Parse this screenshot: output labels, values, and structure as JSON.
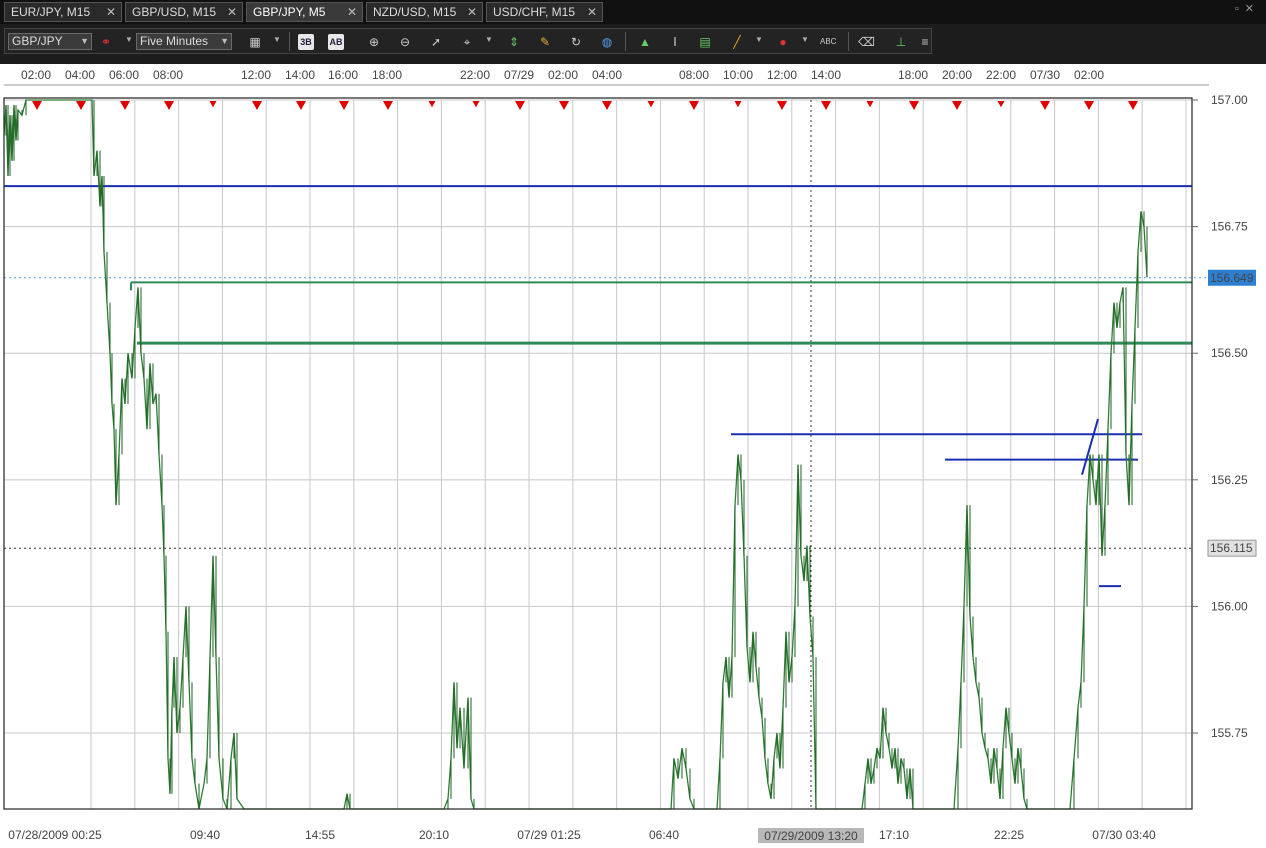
{
  "tabs": [
    {
      "label": "EUR/JPY, M15",
      "active": false
    },
    {
      "label": "GBP/USD, M15",
      "active": false
    },
    {
      "label": "GBP/JPY, M5",
      "active": true
    },
    {
      "label": "NZD/USD, M15",
      "active": false
    },
    {
      "label": "USD/CHF, M15",
      "active": false
    }
  ],
  "toolbar": {
    "symbol": "GBP/JPY",
    "timeframe": "Five Minutes",
    "icons": [
      "chart-type-icon",
      "dropdown-arrow-icon",
      "layout-a-icon",
      "layout-b-icon",
      "zoom-in-icon",
      "zoom-out-icon",
      "cursor-icon",
      "crosshair-icon",
      "dropdown-arrow-icon",
      "vertical-line-icon",
      "note-icon",
      "refresh-icon",
      "globe-icon",
      "indicator-icon",
      "text-cursor-icon",
      "panel-icon",
      "trend-line-icon",
      "dropdown-arrow-icon",
      "marker-icon",
      "dropdown-arrow-icon",
      "abc-text-icon",
      "eraser-icon",
      "tree-icon",
      "menu-icon"
    ]
  },
  "chart_data": {
    "type": "line",
    "symbol": "GBP/JPY",
    "timeframe": "M5",
    "top_axis_labels": [
      "02:00",
      "04:00",
      "06:00",
      "08:00",
      "12:00",
      "14:00",
      "16:00",
      "18:00",
      "22:00",
      "07/29",
      "02:00",
      "04:00",
      "08:00",
      "10:00",
      "12:00",
      "14:00",
      "18:00",
      "20:00",
      "22:00",
      "07/30",
      "02:00"
    ],
    "bottom_axis_labels": [
      "07/28/2009 00:25",
      "09:40",
      "14:55",
      "20:10",
      "07/29 01:25",
      "06:40",
      "17:10",
      "22:25",
      "07/30 03:40"
    ],
    "crosshair_time_label": "07/29/2009 13:20",
    "y_ticks": [
      "157.00",
      "156.75",
      "156.50",
      "156.25",
      "156.00",
      "155.75"
    ],
    "y_axis_range": [
      155.6,
      157.0
    ],
    "current_price": "156.649",
    "crosshair_price": "156.115",
    "horizontal_levels": [
      {
        "price": 156.83,
        "color": "#1a2fb0"
      },
      {
        "price": 156.64,
        "color": "#2e8b57"
      },
      {
        "price": 156.52,
        "color": "#2e8b57"
      },
      {
        "price": 156.34,
        "color": "#1a2fb0"
      },
      {
        "price": 156.29,
        "color": "#1a2fb0"
      },
      {
        "price": 156.04,
        "color": "#1a2fb0"
      }
    ],
    "session_markers": "red-down-triangles",
    "price_path": [
      [
        0,
        156.93
      ],
      [
        2,
        156.99
      ],
      [
        4,
        156.85
      ],
      [
        6,
        156.97
      ],
      [
        8,
        156.88
      ],
      [
        10,
        156.99
      ],
      [
        12,
        156.92
      ],
      [
        14,
        156.98
      ],
      [
        18,
        156.97
      ],
      [
        22,
        157.0
      ],
      [
        30,
        157.0
      ],
      [
        40,
        157.0
      ],
      [
        60,
        157.0
      ],
      [
        80,
        157.0
      ],
      [
        88,
        157.0
      ],
      [
        90,
        156.85
      ],
      [
        93,
        156.9
      ],
      [
        96,
        156.79
      ],
      [
        98,
        156.85
      ],
      [
        100,
        156.7
      ],
      [
        103,
        156.6
      ],
      [
        106,
        156.5
      ],
      [
        108,
        156.4
      ],
      [
        110,
        156.35
      ],
      [
        112,
        156.2
      ],
      [
        115,
        156.3
      ],
      [
        118,
        156.45
      ],
      [
        121,
        156.4
      ],
      [
        124,
        156.5
      ],
      [
        128,
        156.45
      ],
      [
        131,
        156.55
      ],
      [
        134,
        156.63
      ],
      [
        137,
        156.5
      ],
      [
        140,
        156.45
      ],
      [
        143,
        156.35
      ],
      [
        146,
        156.48
      ],
      [
        149,
        156.4
      ],
      [
        152,
        156.42
      ],
      [
        155,
        156.3
      ],
      [
        158,
        156.2
      ],
      [
        160,
        156.1
      ],
      [
        162,
        155.95
      ],
      [
        164,
        155.7
      ],
      [
        166,
        155.63
      ],
      [
        168,
        155.8
      ],
      [
        170,
        155.9
      ],
      [
        173,
        155.75
      ],
      [
        176,
        155.8
      ],
      [
        179,
        155.9
      ],
      [
        182,
        156.0
      ],
      [
        185,
        155.85
      ],
      [
        188,
        155.7
      ],
      [
        191,
        155.65
      ],
      [
        195,
        155.6
      ],
      [
        200,
        155.65
      ],
      [
        203,
        155.7
      ],
      [
        206,
        155.9
      ],
      [
        209,
        156.1
      ],
      [
        212,
        155.9
      ],
      [
        215,
        155.7
      ],
      [
        219,
        155.62
      ],
      [
        223,
        155.6
      ],
      [
        227,
        155.7
      ],
      [
        230,
        155.75
      ],
      [
        233,
        155.62
      ],
      [
        240,
        155.6
      ],
      [
        300,
        155.6
      ],
      [
        340,
        155.6
      ],
      [
        343,
        155.63
      ],
      [
        346,
        155.6
      ],
      [
        440,
        155.6
      ],
      [
        444,
        155.62
      ],
      [
        447,
        155.7
      ],
      [
        450,
        155.85
      ],
      [
        453,
        155.72
      ],
      [
        456,
        155.8
      ],
      [
        460,
        155.68
      ],
      [
        464,
        155.82
      ],
      [
        467,
        155.62
      ],
      [
        470,
        155.6
      ],
      [
        600,
        155.6
      ],
      [
        667,
        155.6
      ],
      [
        670,
        155.7
      ],
      [
        674,
        155.66
      ],
      [
        678,
        155.72
      ],
      [
        682,
        155.68
      ],
      [
        686,
        155.62
      ],
      [
        690,
        155.6
      ],
      [
        713,
        155.6
      ],
      [
        716,
        155.7
      ],
      [
        719,
        155.85
      ],
      [
        722,
        155.9
      ],
      [
        725,
        155.82
      ],
      [
        728,
        155.9
      ],
      [
        731,
        156.2
      ],
      [
        734,
        156.3
      ],
      [
        737,
        156.25
      ],
      [
        740,
        156.1
      ],
      [
        743,
        155.92
      ],
      [
        746,
        155.85
      ],
      [
        749,
        155.95
      ],
      [
        752,
        155.88
      ],
      [
        755,
        155.82
      ],
      [
        758,
        155.78
      ],
      [
        761,
        155.7
      ],
      [
        764,
        155.65
      ],
      [
        767,
        155.62
      ],
      [
        770,
        155.7
      ],
      [
        773,
        155.75
      ],
      [
        776,
        155.68
      ],
      [
        779,
        155.8
      ],
      [
        782,
        155.95
      ],
      [
        785,
        155.85
      ],
      [
        788,
        155.9
      ],
      [
        791,
        156.0
      ],
      [
        794,
        156.28
      ],
      [
        797,
        156.1
      ],
      [
        800,
        156.05
      ],
      [
        803,
        156.12
      ],
      [
        806,
        155.98
      ],
      [
        809,
        155.9
      ],
      [
        812,
        155.6
      ],
      [
        830,
        155.6
      ],
      [
        858,
        155.6
      ],
      [
        861,
        155.65
      ],
      [
        864,
        155.7
      ],
      [
        867,
        155.65
      ],
      [
        870,
        155.68
      ],
      [
        873,
        155.72
      ],
      [
        876,
        155.7
      ],
      [
        879,
        155.8
      ],
      [
        882,
        155.75
      ],
      [
        885,
        155.72
      ],
      [
        888,
        155.68
      ],
      [
        891,
        155.72
      ],
      [
        894,
        155.65
      ],
      [
        897,
        155.7
      ],
      [
        900,
        155.68
      ],
      [
        903,
        155.62
      ],
      [
        906,
        155.68
      ],
      [
        909,
        155.6
      ],
      [
        950,
        155.6
      ],
      [
        954,
        155.72
      ],
      [
        957,
        155.85
      ],
      [
        960,
        156.0
      ],
      [
        963,
        156.2
      ],
      [
        966,
        155.98
      ],
      [
        969,
        155.9
      ],
      [
        972,
        155.85
      ],
      [
        975,
        155.82
      ],
      [
        978,
        155.75
      ],
      [
        981,
        155.72
      ],
      [
        984,
        155.7
      ],
      [
        987,
        155.65
      ],
      [
        990,
        155.72
      ],
      [
        993,
        155.68
      ],
      [
        996,
        155.62
      ],
      [
        999,
        155.72
      ],
      [
        1002,
        155.8
      ],
      [
        1005,
        155.75
      ],
      [
        1008,
        155.7
      ],
      [
        1011,
        155.65
      ],
      [
        1014,
        155.72
      ],
      [
        1017,
        155.68
      ],
      [
        1020,
        155.62
      ],
      [
        1023,
        155.6
      ],
      [
        1066,
        155.6
      ],
      [
        1070,
        155.7
      ],
      [
        1074,
        155.8
      ],
      [
        1077,
        155.85
      ],
      [
        1080,
        156.0
      ],
      [
        1083,
        156.2
      ],
      [
        1086,
        156.3
      ],
      [
        1089,
        156.25
      ],
      [
        1092,
        156.2
      ],
      [
        1095,
        156.3
      ],
      [
        1098,
        156.1
      ],
      [
        1101,
        156.2
      ],
      [
        1104,
        156.35
      ],
      [
        1107,
        156.5
      ],
      [
        1110,
        156.6
      ],
      [
        1113,
        156.55
      ],
      [
        1116,
        156.6
      ],
      [
        1119,
        156.63
      ],
      [
        1122,
        156.3
      ],
      [
        1125,
        156.2
      ],
      [
        1128,
        156.4
      ],
      [
        1131,
        156.55
      ],
      [
        1134,
        156.7
      ],
      [
        1137,
        156.78
      ],
      [
        1140,
        156.75
      ],
      [
        1143,
        156.65
      ]
    ]
  },
  "colors": {
    "price_line": "#2e7d32",
    "marker": "#e00000",
    "current_price_badge": "#2d7fd0"
  }
}
